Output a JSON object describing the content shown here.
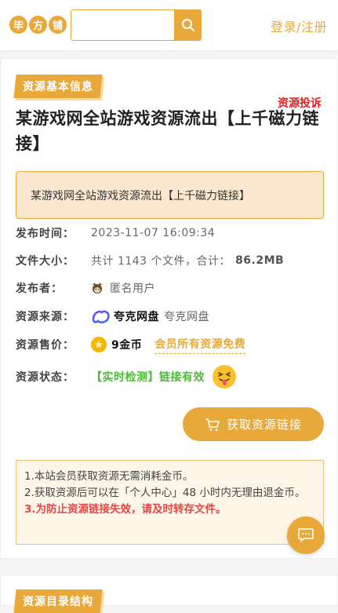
{
  "header": {
    "logo_chars": [
      "毕",
      "方",
      "铺"
    ],
    "search_placeholder": "",
    "login_label": "登录",
    "separator": "/",
    "register_label": "注册"
  },
  "resource": {
    "section_label": "资源基本信息",
    "report_label": "资源投诉",
    "title": "某游戏网全站游戏资源流出【上千磁力链接】",
    "notice": "某游戏网全站游戏资源流出【上千磁力链接】",
    "fields": {
      "publish_time": {
        "label": "发布时间：",
        "value": "2023-11-07 16:09:34"
      },
      "file_size": {
        "label": "文件大小：",
        "value_prefix": "共计 1143 个文件，合计：",
        "value_bold": "86.2MB"
      },
      "publisher": {
        "label": "发布者：",
        "value": "匿名用户"
      },
      "source": {
        "label": "资源来源：",
        "brand": "夸克网盘",
        "value": "夸克网盘"
      },
      "price": {
        "label": "资源售价：",
        "value": "9金币",
        "vip_note": "会员所有资源免费"
      },
      "status": {
        "label": "资源状态：",
        "value": "【实时检测】链接有效"
      }
    },
    "get_button_label": "获取资源链接",
    "tips": [
      "1.本站会员获取资源无需消耗金币。",
      "2.获取资源后可以在「个人中心」48 小时内无理由退金币。",
      "3.为防止资源链接失效，请及时转存文件。"
    ]
  },
  "directory": {
    "section_label": "资源目录结构"
  },
  "colors": {
    "accent": "#e8a93a",
    "danger": "#e02020",
    "success": "#4fb83a"
  }
}
